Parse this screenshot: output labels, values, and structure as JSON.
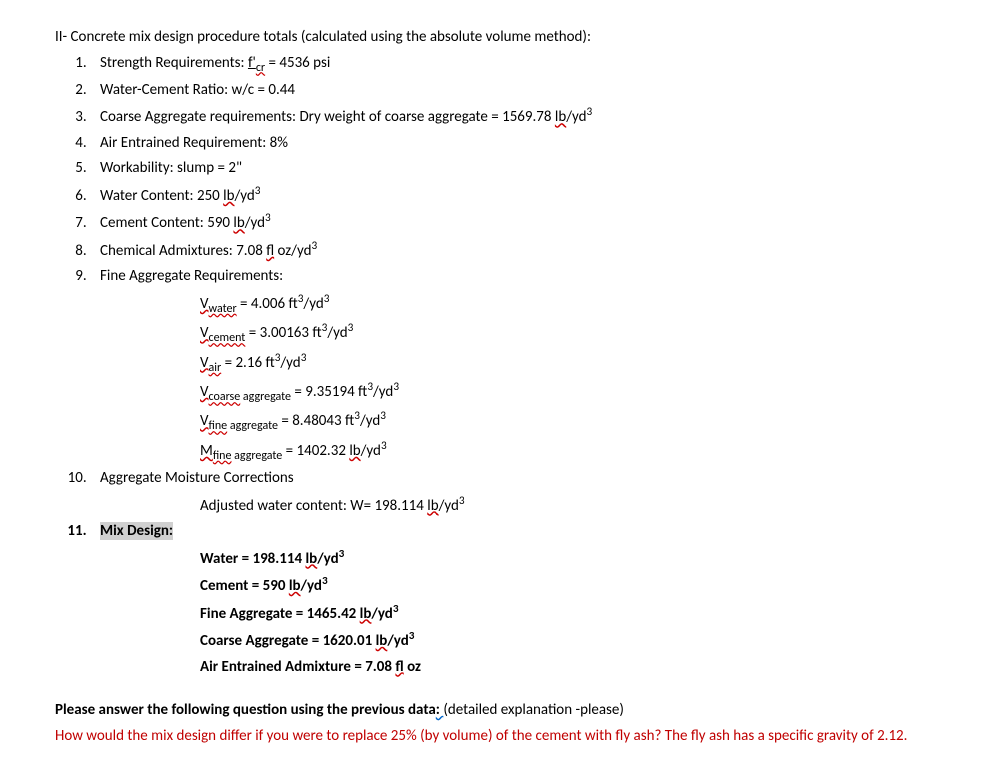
{
  "heading": "II- Concrete mix design procedure totals (calculated using the absolute volume method):",
  "items": {
    "i1_a": "Strength Requirements:  ",
    "i1_b": "f'",
    "i1_c": "cr",
    "i1_d": " = 4536 psi",
    "i2": "Water-Cement Ratio:  w/c = 0.44",
    "i3_a": "Coarse Aggregate requirements:  Dry weight of coarse aggregate = 1569.78 ",
    "i3_b": "lb",
    "i3_c": "/yd",
    "i4": "Air Entrained Requirement:  8%",
    "i5": "Workability:  slump = 2\"",
    "i6_a": "Water Content:  250 ",
    "i6_b": "lb",
    "i6_c": "/yd",
    "i7_a": "Cement Content:  590 ",
    "i7_b": "lb",
    "i7_c": "/yd",
    "i8_a": "Chemical Admixtures:  7.08 ",
    "i8_b": "fl",
    "i8_c": " oz/yd",
    "i9": "Fine Aggregate Requirements:",
    "i10": "Aggregate Moisture Corrections",
    "i11": "Mix Design:"
  },
  "sub9": {
    "l1a": "V",
    "l1b": "water",
    "l1c": " = 4.006 ft",
    "l1d": "/yd",
    "l2a": "V",
    "l2b": "cement",
    "l2c": " = 3.00163 ft",
    "l2d": "/yd",
    "l3a": "V",
    "l3b": "air",
    "l3c": " = 2.16 ft",
    "l3d": "/yd",
    "l4a": "V",
    "l4b": "coarse",
    "l4c": " aggregate",
    "l4d": " = 9.35194 ft",
    "l4e": "/yd",
    "l5a": "V",
    "l5b": "fine",
    "l5c": " aggregate",
    "l5d": " = 8.48043 ft",
    "l5e": "/yd",
    "l6a": "M",
    "l6b": "fine",
    "l6c": " aggregate",
    "l6d": " = 1402.32 ",
    "l6e": "lb",
    "l6f": "/yd"
  },
  "sub10": {
    "l1a": "Adjusted water content: W= 198.114 ",
    "l1b": "lb",
    "l1c": "/yd"
  },
  "mix": {
    "l1a": "Water = 198.114 ",
    "l1b": "lb",
    "l1c": "/yd",
    "l2a": "Cement = 590 ",
    "l2b": "lb",
    "l2c": "/yd",
    "l3a": "Fine Aggregate = 1465.42 ",
    "l3b": "lb",
    "l3c": "/yd",
    "l4a": "Coarse Aggregate = 1620.01 ",
    "l4b": "lb",
    "l4c": "/yd",
    "l5a": "Air Entrained Admixture = 7.08 ",
    "l5b": "fl",
    "l5c": " oz"
  },
  "question": {
    "q1a": "Please answer the following question using the previous data",
    "q1b": ":  ",
    "q1c": "(detailed explanation -please)",
    "q2": "How would the mix design differ if you were to replace 25% (by volume) of the cement with fly ash? The fly ash has a specific gravity of 2.12."
  },
  "sup3": "3"
}
